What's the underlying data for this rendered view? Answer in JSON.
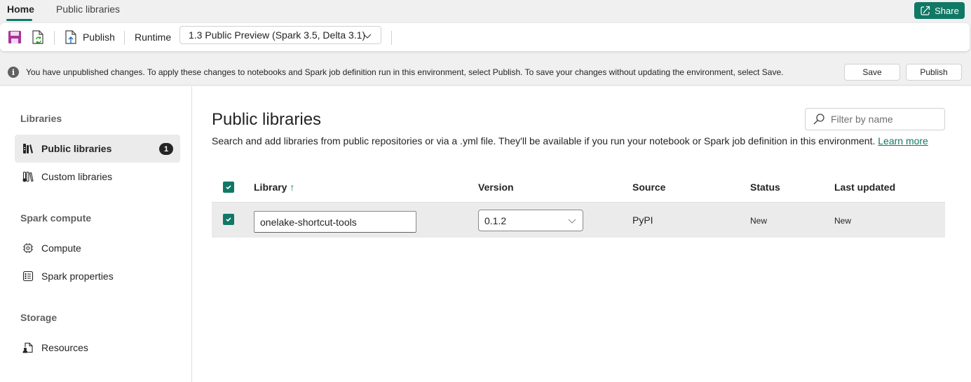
{
  "tabs": [
    {
      "label": "Home",
      "active": true
    },
    {
      "label": "Public libraries",
      "active": false
    }
  ],
  "share_label": "Share",
  "toolbar": {
    "save_icon": "save-icon",
    "update_icon": "refresh-document-icon",
    "publish_label": "Publish",
    "runtime_label": "Runtime",
    "runtime_value": "1.3 Public Preview (Spark 3.5, Delta 3.1)"
  },
  "infobar": {
    "icon": "info-icon",
    "icon_glyph": "i",
    "message": "You have unpublished changes. To apply these changes to notebooks and Spark job definition run in this environment, select Publish. To save your changes without updating the environment, select Save.",
    "save_label": "Save",
    "publish_label": "Publish"
  },
  "sidebar": {
    "sections": [
      {
        "heading": "Libraries",
        "items": [
          {
            "label": "Public libraries",
            "icon": "public-libraries-icon",
            "active": true,
            "badge": "1"
          },
          {
            "label": "Custom libraries",
            "icon": "custom-libraries-icon",
            "active": false
          }
        ]
      },
      {
        "heading": "Spark compute",
        "items": [
          {
            "label": "Compute",
            "icon": "compute-chip-icon",
            "active": false
          },
          {
            "label": "Spark properties",
            "icon": "properties-list-icon",
            "active": false
          }
        ]
      },
      {
        "heading": "Storage",
        "items": [
          {
            "label": "Resources",
            "icon": "resources-document-icon",
            "active": false
          }
        ]
      }
    ]
  },
  "main": {
    "title": "Public libraries",
    "description": "Search and add libraries from public repositories or via a .yml file. They'll be available if you run your notebook or Spark job definition in this environment.",
    "learn_more": "Learn more",
    "filter_placeholder": "Filter by name",
    "table": {
      "columns": [
        "Library",
        "Version",
        "Source",
        "Status",
        "Last updated"
      ],
      "sort_indicator": "↑",
      "header_checked": true,
      "rows": [
        {
          "checked": true,
          "library": "onelake-shortcut-tools",
          "version": "0.1.2",
          "source": "PyPI",
          "status": "New",
          "last_updated": "New"
        }
      ]
    }
  },
  "colors": {
    "accent": "#117865",
    "save_icon": "#a8359b"
  }
}
